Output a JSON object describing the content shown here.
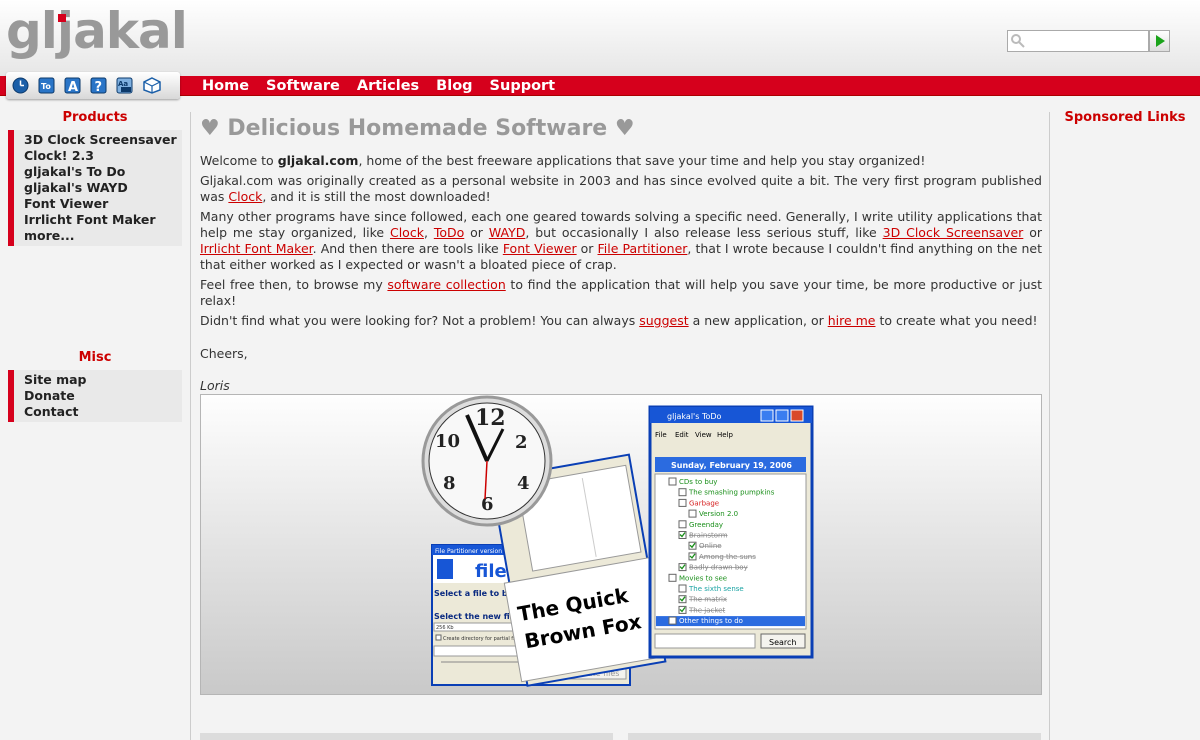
{
  "header": {
    "logo_text": "gljakal",
    "search": {
      "placeholder": ""
    }
  },
  "icon_bar": {
    "icons": [
      "clock-icon",
      "todo-icon",
      "font-icon",
      "help-icon",
      "irrlicht-icon",
      "cube-icon"
    ]
  },
  "nav": {
    "links": [
      "Home",
      "Software",
      "Articles",
      "Blog",
      "Support"
    ]
  },
  "left": {
    "products_title": "Products",
    "products": [
      "3D Clock Screensaver",
      "Clock! 2.3",
      "gljakal's To Do",
      "gljakal's WAYD",
      "Font Viewer",
      "Irrlicht Font Maker",
      "more..."
    ],
    "misc_title": "Misc",
    "misc": [
      "Site map",
      "Donate",
      "Contact"
    ]
  },
  "main": {
    "title": "♥ Delicious Homemade Software ♥",
    "p1_a": "Welcome to ",
    "p1_b": "gljakal.com",
    "p1_c": ", home of the best freeware applications that save your time and help you stay organized!",
    "p2_a": "Gljakal.com was originally created as a personal website in 2003 and has since evolved quite a bit. The very first program published was ",
    "p2_link": "Clock",
    "p2_b": ", and it is still the most downloaded!",
    "p3_a": "Many other programs have since followed, each one geared towards solving a specific need. Generally, I write utility applications that help me stay organized, like ",
    "p3_l1": "Clock",
    "p3_sep1": ", ",
    "p3_l2": "ToDo",
    "p3_or1": " or ",
    "p3_l3": "WAYD",
    "p3_b": ", but occasionally I also release less serious stuff, like ",
    "p3_l4": "3D Clock Screensaver",
    "p3_or2": " or ",
    "p3_l5": "Irrlicht Font Maker",
    "p3_c": ". And then there are tools like ",
    "p3_l6": "Font Viewer",
    "p3_or3": " or ",
    "p3_l7": "File Partitioner",
    "p3_d": ", that I wrote because I couldn't find anything on the net that either worked as I expected or wasn't a bloated piece of crap.",
    "p4_a": "Feel free then, to browse my ",
    "p4_link": "software collection",
    "p4_b": " to find the application that will help you save your time, be more productive or just relax!",
    "p5_a": "Didn't find what you were looking for? Not a problem! You can always ",
    "p5_l1": "suggest",
    "p5_b": " a new application, or ",
    "p5_l2": "hire me",
    "p5_c": " to create what you need!",
    "cheers": "Cheers,",
    "signature": "Loris"
  },
  "screenshot": {
    "todo_title": "gljakal's ToDo",
    "todo_menu": [
      "File",
      "Edit",
      "View",
      "Help"
    ],
    "todo_date": "Sunday, February 19, 2006",
    "todo_items": [
      {
        "text": "CDs to buy",
        "color": "#1a8f1a",
        "indent": 0,
        "checked": false
      },
      {
        "text": "The smashing pumpkins",
        "color": "#1a8f1a",
        "indent": 1,
        "checked": false
      },
      {
        "text": "Garbage",
        "color": "#d62020",
        "indent": 1,
        "checked": false
      },
      {
        "text": "Version 2.0",
        "color": "#1a8f1a",
        "indent": 2,
        "checked": false
      },
      {
        "text": "Greenday",
        "color": "#1a8f1a",
        "indent": 1,
        "checked": false
      },
      {
        "text": "Brainstorm",
        "color": "#888888",
        "indent": 1,
        "checked": true
      },
      {
        "text": "Online",
        "color": "#888888",
        "indent": 2,
        "checked": true
      },
      {
        "text": "Among the suns",
        "color": "#888888",
        "indent": 2,
        "checked": true
      },
      {
        "text": "Badly drawn boy",
        "color": "#888888",
        "indent": 1,
        "checked": true
      },
      {
        "text": "Movies to see",
        "color": "#1a8f1a",
        "indent": 0,
        "checked": false
      },
      {
        "text": "The sixth sense",
        "color": "#1aa3a3",
        "indent": 1,
        "checked": false
      },
      {
        "text": "The matrix",
        "color": "#888888",
        "indent": 1,
        "checked": true
      },
      {
        "text": "The jacket",
        "color": "#888888",
        "indent": 1,
        "checked": true
      },
      {
        "text": "Other things to do",
        "color": "#ffffff",
        "indent": 0,
        "checked": false
      }
    ],
    "todo_search": "Search",
    "font_sample_1": "The Quick",
    "font_sample_2": "Brown Fox",
    "fp_title": "File Partitioner version",
    "fp_heading": "file",
    "fp_select1": "Select a file to b",
    "fp_select2": "Select the new fi",
    "fp_size": "256 Kb",
    "fp_checkbox": "Create directory for partial files",
    "fp_button": "Create files"
  },
  "right": {
    "sponsored_title": "Sponsored Links"
  },
  "colors": {
    "brand_red": "#d6001c",
    "link_red": "#cc0000"
  }
}
